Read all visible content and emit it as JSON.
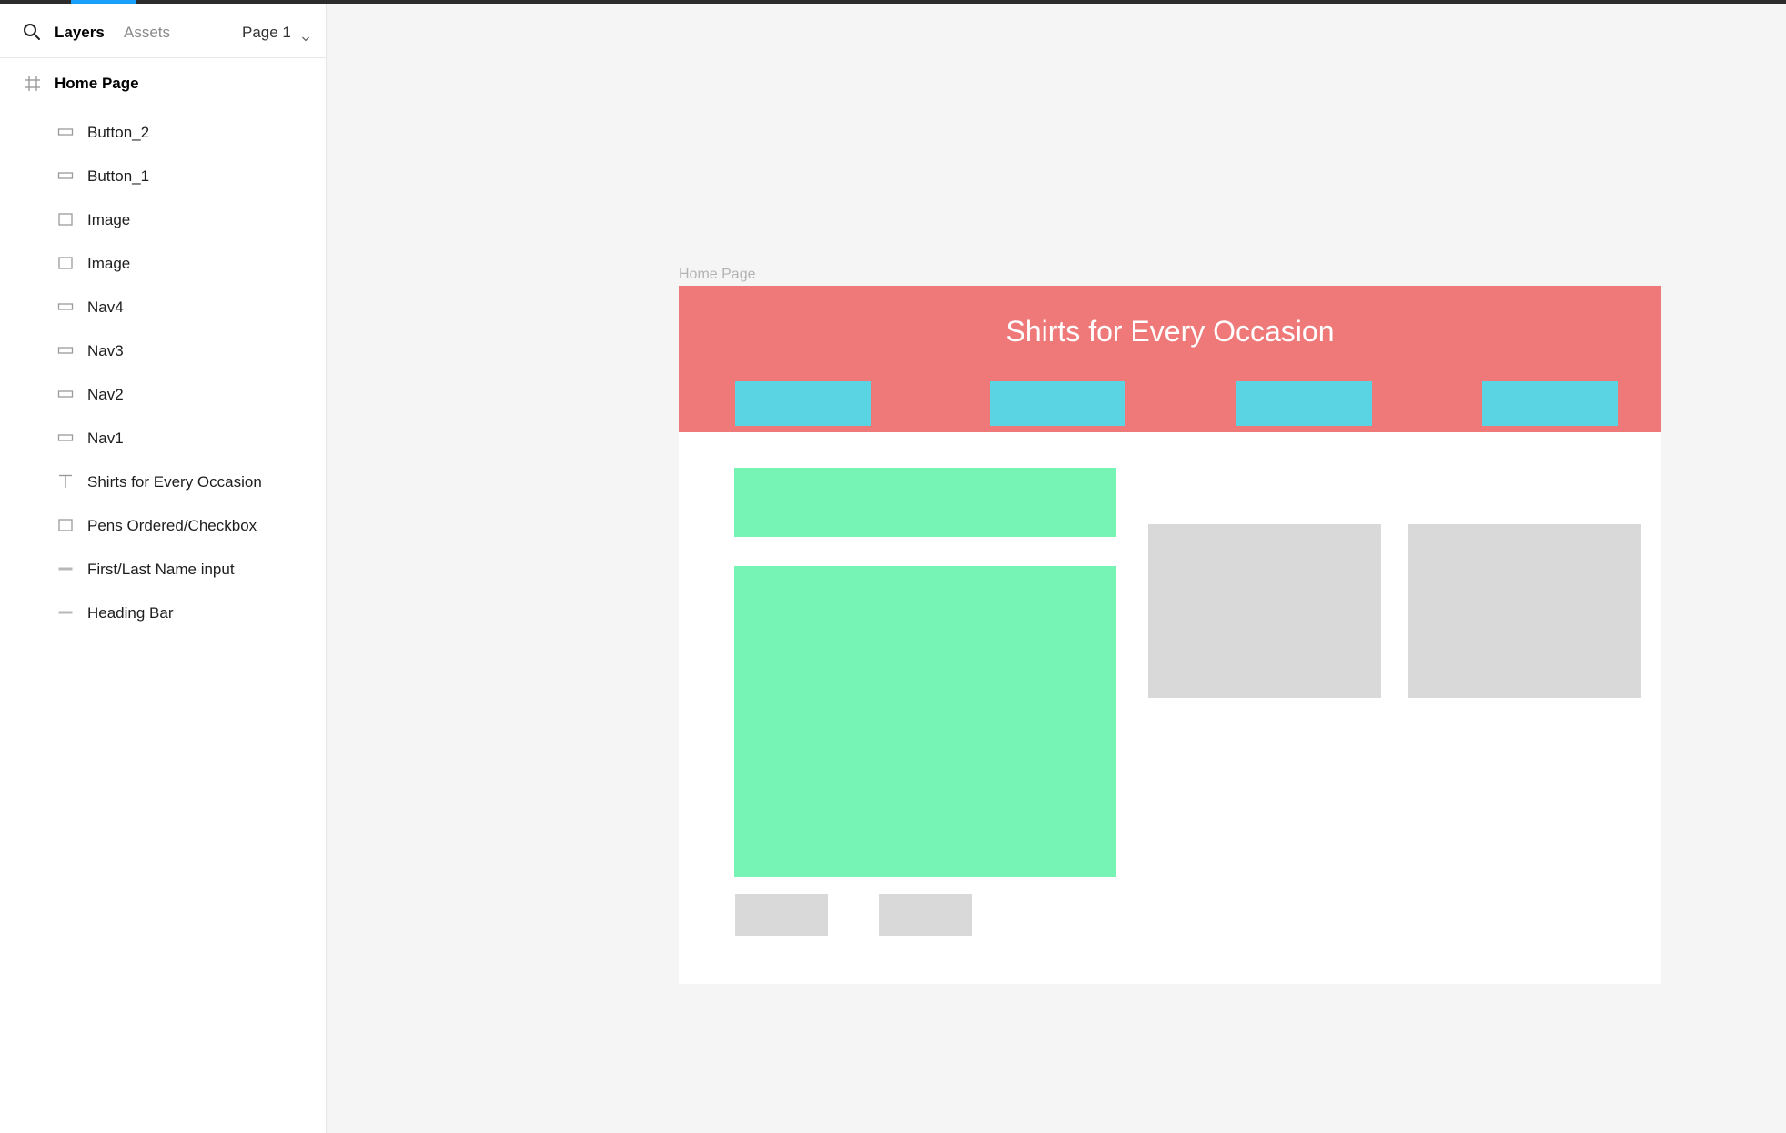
{
  "sidebar": {
    "tabs": {
      "layers": "Layers",
      "assets": "Assets"
    },
    "page_select": "Page 1",
    "frame": {
      "label": "Home Page",
      "icon": "frame-icon"
    },
    "layers": [
      {
        "label": "Button_2",
        "icon": "rectangle-icon"
      },
      {
        "label": "Button_1",
        "icon": "rectangle-icon"
      },
      {
        "label": "Image",
        "icon": "square-icon"
      },
      {
        "label": "Image",
        "icon": "square-icon"
      },
      {
        "label": "Nav4",
        "icon": "rectangle-icon"
      },
      {
        "label": "Nav3",
        "icon": "rectangle-icon"
      },
      {
        "label": "Nav2",
        "icon": "rectangle-icon"
      },
      {
        "label": "Nav1",
        "icon": "rectangle-icon"
      },
      {
        "label": "Shirts for Every Occasion",
        "icon": "text-icon"
      },
      {
        "label": "Pens Ordered/Checkbox",
        "icon": "square-icon"
      },
      {
        "label": "First/Last Name input",
        "icon": "bar-icon"
      },
      {
        "label": "Heading Bar",
        "icon": "bar-icon"
      }
    ]
  },
  "canvas": {
    "frame_title": "Home Page",
    "heading_text": "Shirts for Every Occasion",
    "colors": {
      "heading_bar": "#ef7979",
      "nav": "#5ad3e3",
      "green": "#75f4b5",
      "placeholder": "#d9d9d9",
      "accent": "#18a0fb"
    }
  }
}
